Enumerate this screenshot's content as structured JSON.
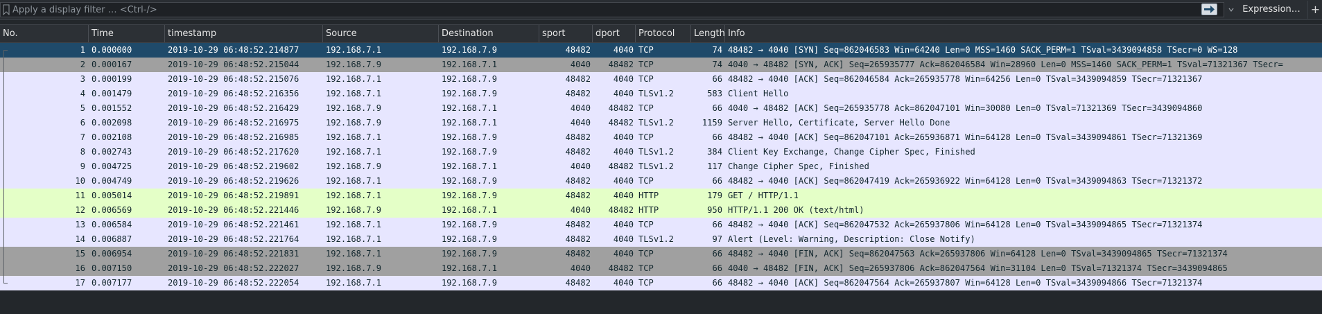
{
  "filter": {
    "placeholder": "Apply a display filter … <Ctrl-/>",
    "expression_label": "Expression…",
    "plus_label": "+"
  },
  "colors": {
    "tcp_row": "#e7e6ff",
    "http_row": "#e4ffc7",
    "fin_syn_row": "#a0a0a0",
    "selected_row": "#1f4a6a"
  },
  "columns": [
    "No.",
    "Time",
    "timestamp",
    "Source",
    "Destination",
    "sport",
    "dport",
    "Protocol",
    "Length",
    "Info"
  ],
  "packets": [
    {
      "no": "1",
      "time": "0.000000",
      "ts": "2019-10-29 06:48:52.214877",
      "src": "192.168.7.1",
      "dst": "192.168.7.9",
      "sport": "48482",
      "dport": "4040",
      "proto": "TCP",
      "len": "74",
      "info": "48482 → 4040 [SYN] Seq=862046583 Win=64240 Len=0 MSS=1460 SACK_PERM=1 TSval=3439094858 TSecr=0 WS=128",
      "style": "sel"
    },
    {
      "no": "2",
      "time": "0.000167",
      "ts": "2019-10-29 06:48:52.215044",
      "src": "192.168.7.9",
      "dst": "192.168.7.1",
      "sport": "4040",
      "dport": "48482",
      "proto": "TCP",
      "len": "74",
      "info": "4040 → 48482 [SYN, ACK] Seq=265935777 Ack=862046584 Win=28960 Len=0 MSS=1460 SACK_PERM=1 TSval=71321367 TSecr=",
      "style": "syn"
    },
    {
      "no": "3",
      "time": "0.000199",
      "ts": "2019-10-29 06:48:52.215076",
      "src": "192.168.7.1",
      "dst": "192.168.7.9",
      "sport": "48482",
      "dport": "4040",
      "proto": "TCP",
      "len": "66",
      "info": "48482 → 4040 [ACK] Seq=862046584 Ack=265935778 Win=64256 Len=0 TSval=3439094859 TSecr=71321367",
      "style": "tcp"
    },
    {
      "no": "4",
      "time": "0.001479",
      "ts": "2019-10-29 06:48:52.216356",
      "src": "192.168.7.1",
      "dst": "192.168.7.9",
      "sport": "48482",
      "dport": "4040",
      "proto": "TLSv1.2",
      "len": "583",
      "info": "Client Hello",
      "style": "tls"
    },
    {
      "no": "5",
      "time": "0.001552",
      "ts": "2019-10-29 06:48:52.216429",
      "src": "192.168.7.9",
      "dst": "192.168.7.1",
      "sport": "4040",
      "dport": "48482",
      "proto": "TCP",
      "len": "66",
      "info": "4040 → 48482 [ACK] Seq=265935778 Ack=862047101 Win=30080 Len=0 TSval=71321369 TSecr=3439094860",
      "style": "tcp"
    },
    {
      "no": "6",
      "time": "0.002098",
      "ts": "2019-10-29 06:48:52.216975",
      "src": "192.168.7.9",
      "dst": "192.168.7.1",
      "sport": "4040",
      "dport": "48482",
      "proto": "TLSv1.2",
      "len": "1159",
      "info": "Server Hello, Certificate, Server Hello Done",
      "style": "tls"
    },
    {
      "no": "7",
      "time": "0.002108",
      "ts": "2019-10-29 06:48:52.216985",
      "src": "192.168.7.1",
      "dst": "192.168.7.9",
      "sport": "48482",
      "dport": "4040",
      "proto": "TCP",
      "len": "66",
      "info": "48482 → 4040 [ACK] Seq=862047101 Ack=265936871 Win=64128 Len=0 TSval=3439094861 TSecr=71321369",
      "style": "tcp"
    },
    {
      "no": "8",
      "time": "0.002743",
      "ts": "2019-10-29 06:48:52.217620",
      "src": "192.168.7.1",
      "dst": "192.168.7.9",
      "sport": "48482",
      "dport": "4040",
      "proto": "TLSv1.2",
      "len": "384",
      "info": "Client Key Exchange, Change Cipher Spec, Finished",
      "style": "tls"
    },
    {
      "no": "9",
      "time": "0.004725",
      "ts": "2019-10-29 06:48:52.219602",
      "src": "192.168.7.9",
      "dst": "192.168.7.1",
      "sport": "4040",
      "dport": "48482",
      "proto": "TLSv1.2",
      "len": "117",
      "info": "Change Cipher Spec, Finished",
      "style": "tls"
    },
    {
      "no": "10",
      "time": "0.004749",
      "ts": "2019-10-29 06:48:52.219626",
      "src": "192.168.7.1",
      "dst": "192.168.7.9",
      "sport": "48482",
      "dport": "4040",
      "proto": "TCP",
      "len": "66",
      "info": "48482 → 4040 [ACK] Seq=862047419 Ack=265936922 Win=64128 Len=0 TSval=3439094863 TSecr=71321372",
      "style": "tcp"
    },
    {
      "no": "11",
      "time": "0.005014",
      "ts": "2019-10-29 06:48:52.219891",
      "src": "192.168.7.1",
      "dst": "192.168.7.9",
      "sport": "48482",
      "dport": "4040",
      "proto": "HTTP",
      "len": "179",
      "info": "GET / HTTP/1.1",
      "style": "http"
    },
    {
      "no": "12",
      "time": "0.006569",
      "ts": "2019-10-29 06:48:52.221446",
      "src": "192.168.7.9",
      "dst": "192.168.7.1",
      "sport": "4040",
      "dport": "48482",
      "proto": "HTTP",
      "len": "950",
      "info": "HTTP/1.1 200 OK  (text/html)",
      "style": "http"
    },
    {
      "no": "13",
      "time": "0.006584",
      "ts": "2019-10-29 06:48:52.221461",
      "src": "192.168.7.1",
      "dst": "192.168.7.9",
      "sport": "48482",
      "dport": "4040",
      "proto": "TCP",
      "len": "66",
      "info": "48482 → 4040 [ACK] Seq=862047532 Ack=265937806 Win=64128 Len=0 TSval=3439094865 TSecr=71321374",
      "style": "tcp"
    },
    {
      "no": "14",
      "time": "0.006887",
      "ts": "2019-10-29 06:48:52.221764",
      "src": "192.168.7.1",
      "dst": "192.168.7.9",
      "sport": "48482",
      "dport": "4040",
      "proto": "TLSv1.2",
      "len": "97",
      "info": "Alert (Level: Warning, Description: Close Notify)",
      "style": "tls"
    },
    {
      "no": "15",
      "time": "0.006954",
      "ts": "2019-10-29 06:48:52.221831",
      "src": "192.168.7.1",
      "dst": "192.168.7.9",
      "sport": "48482",
      "dport": "4040",
      "proto": "TCP",
      "len": "66",
      "info": "48482 → 4040 [FIN, ACK] Seq=862047563 Ack=265937806 Win=64128 Len=0 TSval=3439094865 TSecr=71321374",
      "style": "syn"
    },
    {
      "no": "16",
      "time": "0.007150",
      "ts": "2019-10-29 06:48:52.222027",
      "src": "192.168.7.9",
      "dst": "192.168.7.1",
      "sport": "4040",
      "dport": "48482",
      "proto": "TCP",
      "len": "66",
      "info": "4040 → 48482 [FIN, ACK] Seq=265937806 Ack=862047564 Win=31104 Len=0 TSval=71321374 TSecr=3439094865",
      "style": "syn"
    },
    {
      "no": "17",
      "time": "0.007177",
      "ts": "2019-10-29 06:48:52.222054",
      "src": "192.168.7.1",
      "dst": "192.168.7.9",
      "sport": "48482",
      "dport": "4040",
      "proto": "TCP",
      "len": "66",
      "info": "48482 → 4040 [ACK] Seq=862047564 Ack=265937807 Win=64128 Len=0 TSval=3439094866 TSecr=71321374",
      "style": "tcp"
    }
  ]
}
